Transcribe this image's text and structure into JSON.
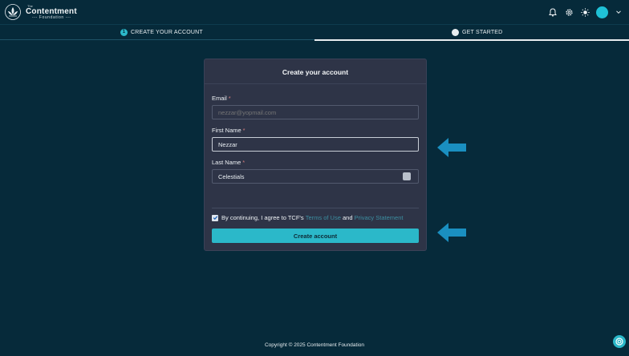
{
  "brand": {
    "the": "The",
    "name": "Contentment",
    "sub": "Foundation"
  },
  "header_icons": [
    "bell-icon",
    "gear-icon",
    "sun-icon",
    "avatar",
    "chevron-down-icon"
  ],
  "stepper": {
    "steps": [
      {
        "number": "1",
        "label": "CREATE YOUR ACCOUNT"
      },
      {
        "number": "",
        "label": "GET STARTED"
      }
    ],
    "progress": 0.5
  },
  "form": {
    "title": "Create your account",
    "email": {
      "label": "Email",
      "required": "*",
      "value": "",
      "placeholder": "nezzar@yopmail.com"
    },
    "first_name": {
      "label": "First Name",
      "required": "*",
      "value": "Nezzar"
    },
    "last_name": {
      "label": "Last Name",
      "required": "*",
      "value": "Celestials"
    },
    "consent": {
      "checked": true,
      "prefix": "By continuing, I agree to TCF's ",
      "terms": "Terms of Use",
      "and": " and ",
      "privacy": "Privacy Statement"
    },
    "submit_label": "Create account"
  },
  "footer": {
    "copyright": "Copyright © 2025 Contentment Foundation"
  },
  "colors": {
    "background": "#062a3a",
    "card": "#2e3447",
    "accent": "#2bb8c9",
    "arrow": "#1a8fc0"
  }
}
